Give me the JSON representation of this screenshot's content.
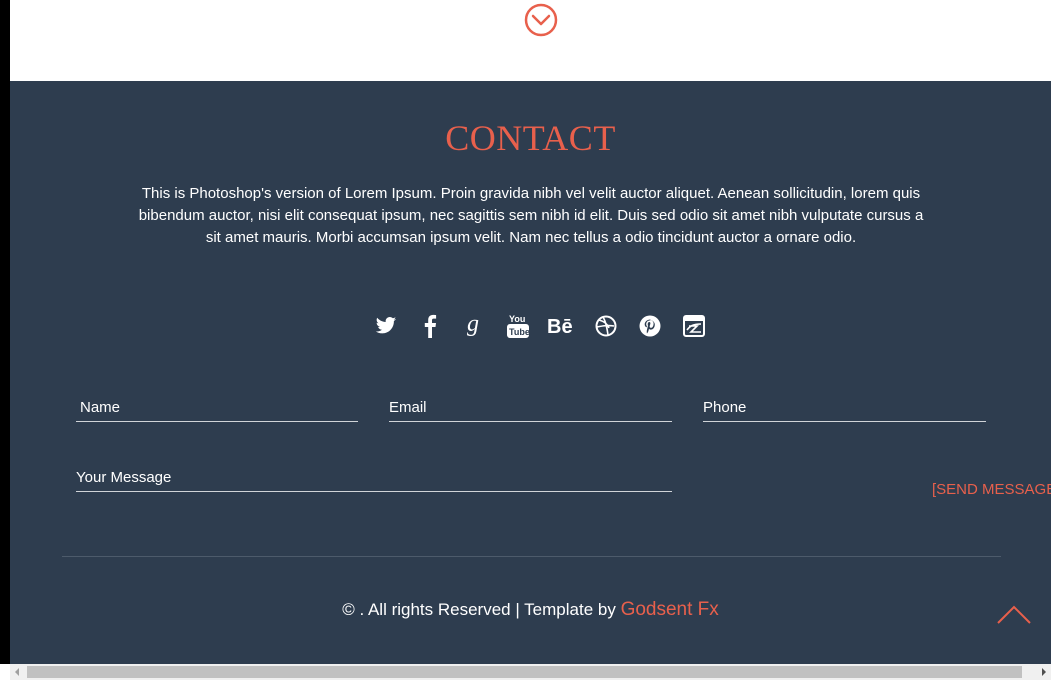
{
  "colors": {
    "accent": "#e8604c",
    "section_bg": "#2e3d4f",
    "text": "#ffffff"
  },
  "scroll_down_icon": "chevron-down-circle-icon",
  "contact": {
    "title": "CONTACT",
    "description": "This is Photoshop's version of Lorem Ipsum. Proin gravida nibh vel velit auctor aliquet. Aenean sollicitudin, lorem quis bibendum auctor, nisi elit consequat ipsum, nec sagittis sem nibh id elit. Duis sed odio sit amet nibh vulputate cursus a sit amet mauris. Morbi accumsan ipsum velit. Nam nec tellus a odio tincidunt auctor a ornare odio."
  },
  "social": [
    "twitter-icon",
    "facebook-icon",
    "google-plus-icon",
    "youtube-icon",
    "behance-icon",
    "dribbble-icon",
    "pinterest-icon",
    "deviantart-icon"
  ],
  "form": {
    "name_placeholder": "Name",
    "email_placeholder": "Email",
    "phone_placeholder": "Phone",
    "message_placeholder": "Your Message",
    "send_label": "[SEND MESSAGE]"
  },
  "footer": {
    "copyright": "© . All rights Reserved | Template by ",
    "brand": "Godsent Fx"
  },
  "back_to_top_icon": "chevron-up-icon"
}
